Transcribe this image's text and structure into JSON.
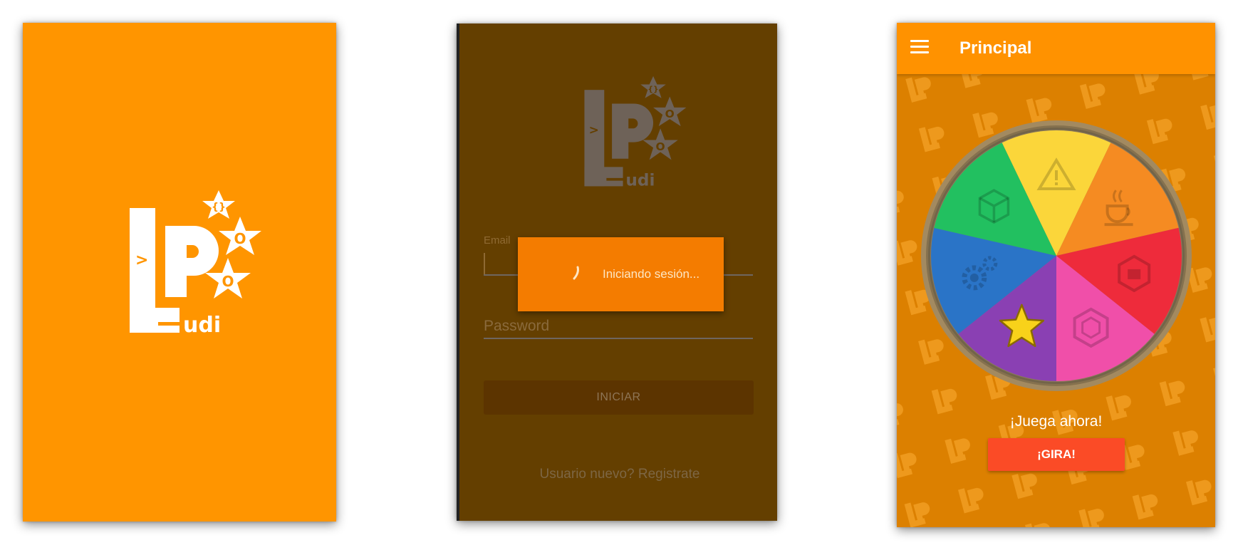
{
  "screens": {
    "splash": {
      "logo": {
        "letters": "LP",
        "prompt_symbol": ">",
        "suffix": "udi",
        "stars": [
          "{}",
          "O",
          "O"
        ]
      }
    },
    "login": {
      "logo": {
        "letters": "LP",
        "prompt_symbol": ">",
        "suffix": "udi",
        "stars": [
          "{}",
          "O",
          "O"
        ]
      },
      "email_label": "Email",
      "email_value": "",
      "password_placeholder": "Password",
      "submit_label": "INICIAR",
      "register_link": "Usuario nuevo? Registrate",
      "progress_dialog": {
        "message": "Iniciando sesión..."
      }
    },
    "main": {
      "title": "Principal",
      "wheel": {
        "segments": [
          {
            "color": "#fbd63a",
            "icon": "warning-icon"
          },
          {
            "color": "#f58b22",
            "icon": "java-cup-icon"
          },
          {
            "color": "#ee2b3b",
            "icon": "hexagon-icon"
          },
          {
            "color": "#f04fa9",
            "icon": "hexagon-outline-icon"
          },
          {
            "color": "#8a40b3",
            "icon": "star-icon"
          },
          {
            "color": "#2a74c7",
            "icon": "gears-icon"
          },
          {
            "color": "#22c060",
            "icon": "cube-icon"
          }
        ]
      },
      "play_text": "¡Juega ahora!",
      "spin_button": "¡GIRA!"
    }
  },
  "colors": {
    "brand_orange": "#ff9500",
    "dim_overlay": "#643f00",
    "spin_button": "#fb4b26"
  }
}
